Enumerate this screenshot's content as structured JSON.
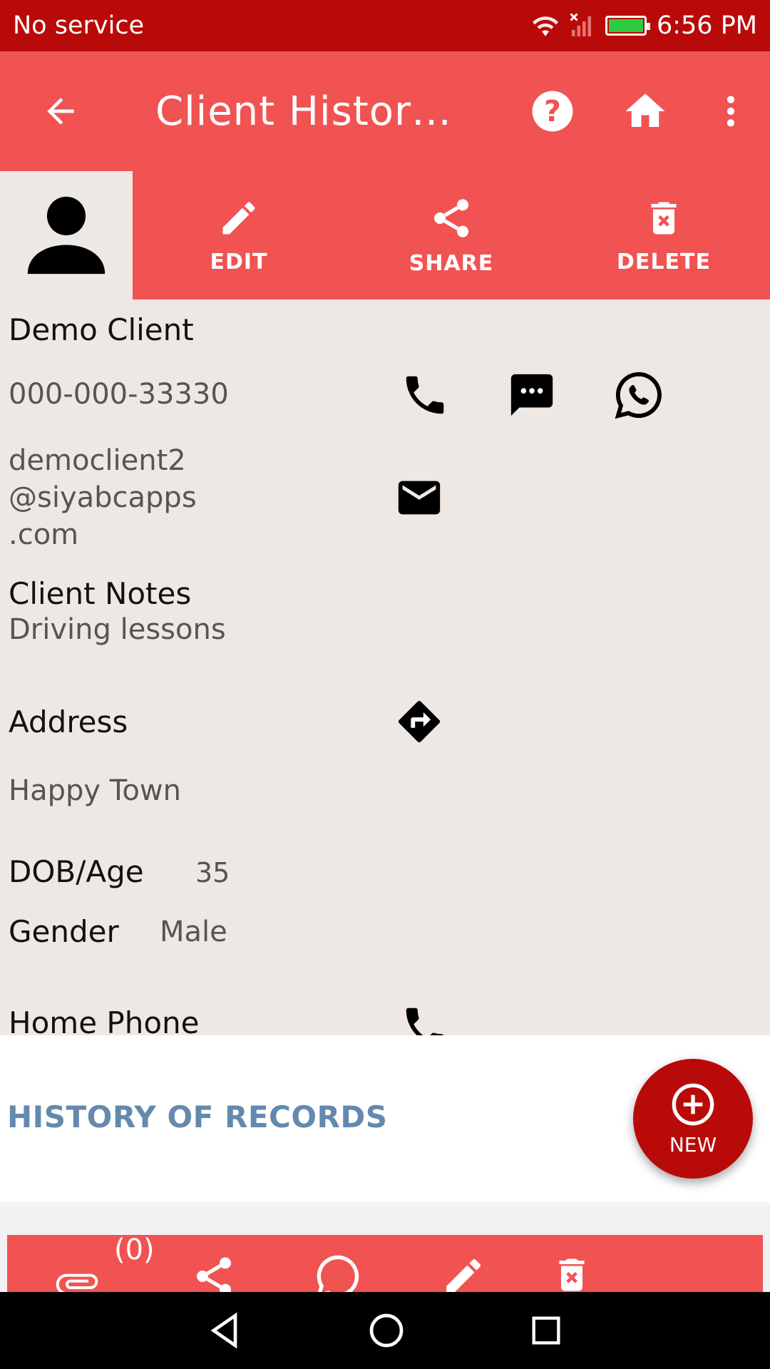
{
  "status_bar": {
    "carrier": "No service",
    "time": "6:56 PM",
    "icons": [
      "wifi-icon",
      "signal-icon",
      "battery-charging-icon"
    ]
  },
  "app_bar": {
    "title": "Client Histor…",
    "icons": [
      "back-arrow-icon",
      "help-icon",
      "home-icon",
      "more-vert-icon"
    ]
  },
  "actions": {
    "edit": "EDIT",
    "share": "SHARE",
    "delete": "DELETE"
  },
  "client": {
    "name": "Demo Client",
    "phone": "000-000-33330",
    "email_lines": [
      "democlient2",
      "@siyabcapps",
      ".com"
    ],
    "notes_label": "Client Notes",
    "notes_value": "Driving lessons",
    "address_label": "Address",
    "address_value": "Happy Town",
    "dob_label": "DOB/Age",
    "dob_value": "35",
    "gender_label": "Gender",
    "gender_value": "Male",
    "home_phone_label": "Home Phone"
  },
  "history": {
    "title": "HISTORY OF RECORDS",
    "new_label": "NEW"
  },
  "record_bar": {
    "attachment_count": "(0)"
  },
  "colors": {
    "status_bar": "#b90a0a",
    "primary": "#f05352",
    "background": "#ede8e3",
    "fab": "#b90a0a",
    "history_title": "#6489ae"
  }
}
